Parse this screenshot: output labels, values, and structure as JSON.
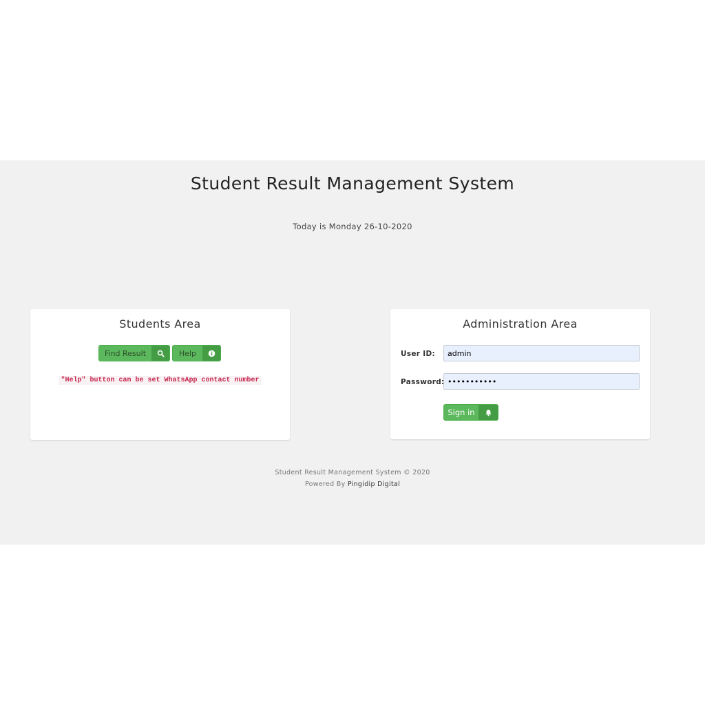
{
  "header": {
    "title": "Student Result Management System",
    "date_text": "Today is Monday 26-10-2020"
  },
  "students": {
    "title": "Students Area",
    "find_result_label": "Find Result",
    "find_result_icon": "search-icon",
    "help_label": "Help",
    "help_icon": "info-icon",
    "note": "\"Help\" button can be set WhatsApp contact number"
  },
  "admin": {
    "title": "Administration Area",
    "user_id_label": "User ID:",
    "user_id_value": "admin",
    "password_label": "Password:",
    "password_value": "adminpasswd",
    "sign_in_label": "Sign in",
    "sign_in_icon": "bell-icon"
  },
  "footer": {
    "copyright": "Student Result Management System © 2020",
    "powered_prefix": "Powered By",
    "powered_link": "Pingidip Digital"
  },
  "colors": {
    "band_background": "#f1f1f1",
    "button_green": "#5cb85c",
    "button_icon_green": "#449d44",
    "note_red": "#c7254e",
    "input_fill": "#e8f0fe"
  }
}
